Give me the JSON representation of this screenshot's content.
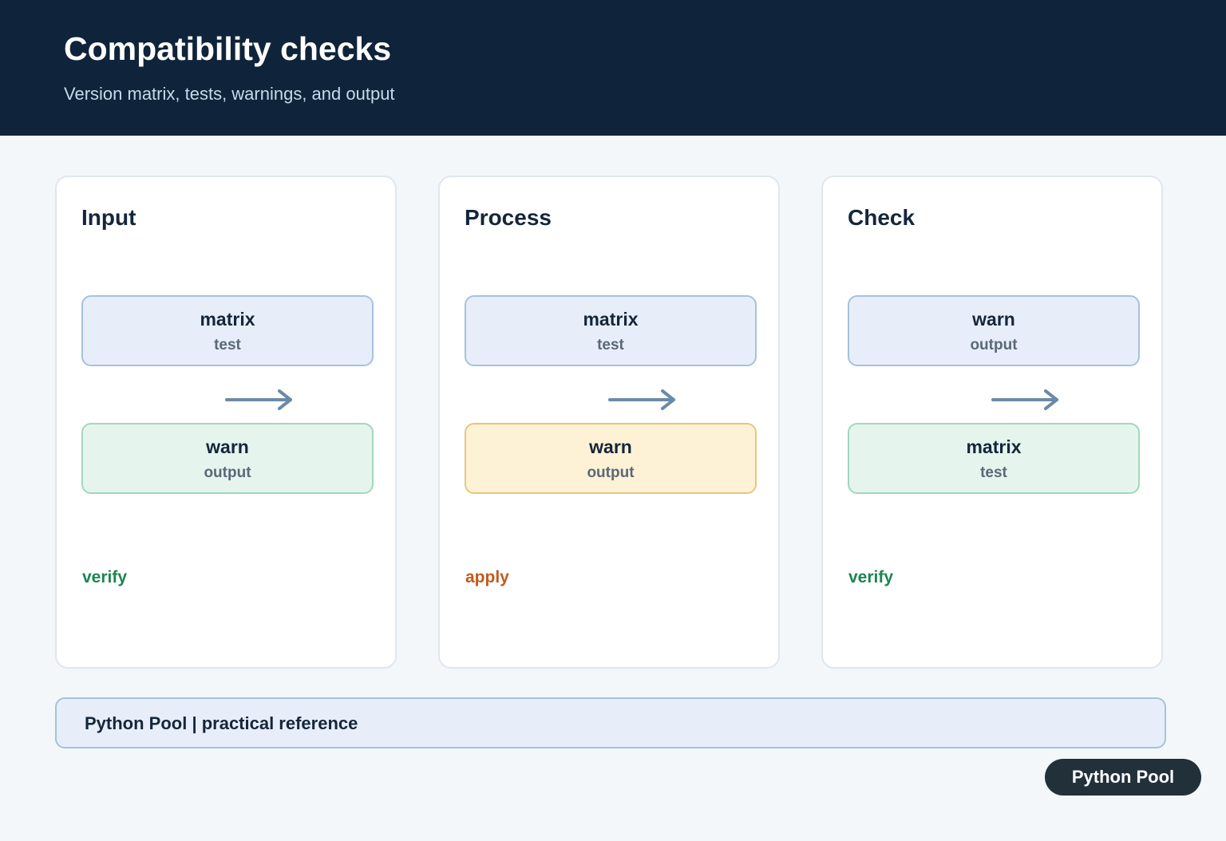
{
  "header": {
    "title": "Compatibility checks",
    "subtitle": "Version matrix, tests, warnings, and output"
  },
  "columns": [
    {
      "title": "Input",
      "top_box": {
        "label": "matrix",
        "sub": "test",
        "style": "blue"
      },
      "bottom_box": {
        "label": "warn",
        "sub": "output",
        "style": "green"
      },
      "tag": "verify",
      "tag_color": "#1a8650"
    },
    {
      "title": "Process",
      "top_box": {
        "label": "matrix",
        "sub": "test",
        "style": "blue"
      },
      "bottom_box": {
        "label": "warn",
        "sub": "output",
        "style": "yellow"
      },
      "tag": "apply",
      "tag_color": "#c25a1e"
    },
    {
      "title": "Check",
      "top_box": {
        "label": "warn",
        "sub": "output",
        "style": "blue"
      },
      "bottom_box": {
        "label": "matrix",
        "sub": "test",
        "style": "green"
      },
      "tag": "verify",
      "tag_color": "#1a8650"
    }
  ],
  "footer": {
    "text": "Python Pool | practical reference"
  },
  "badge": {
    "label": "Python Pool"
  },
  "colors": {
    "header_bg": "#0f243a",
    "arrow": "#6b8aa7"
  }
}
